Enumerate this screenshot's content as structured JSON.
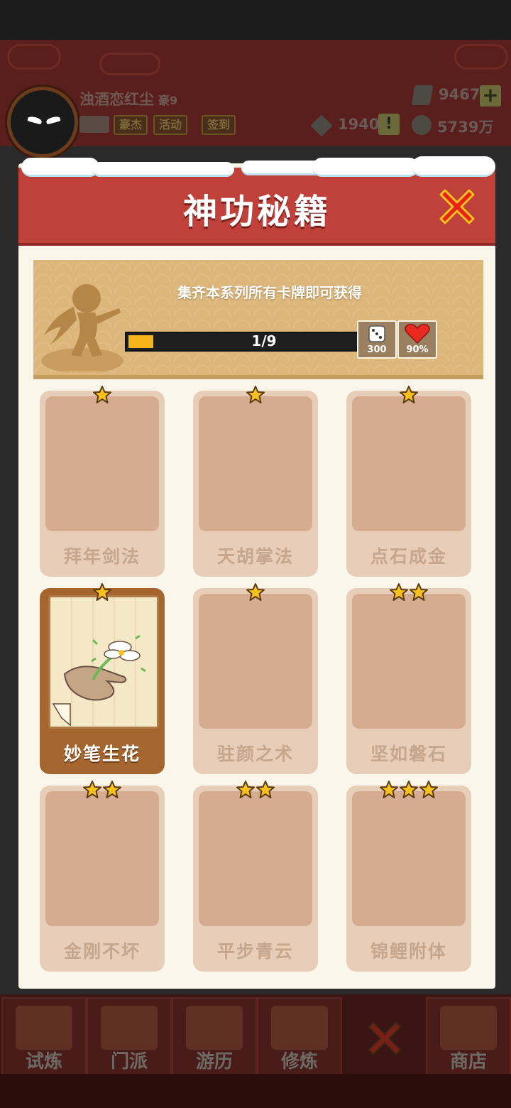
{
  "player": {
    "name": "浊酒恋红尘",
    "level": "豪9",
    "tags": [
      "豪杰",
      "活动",
      "签到"
    ]
  },
  "resources": {
    "gems": "9467",
    "tokens": "1940",
    "coins": "5739万"
  },
  "modal": {
    "title": "神功秘籍",
    "banner_text": "集齐本系列所有卡牌即可获得",
    "progress_label": "1/9",
    "progress": 0.11,
    "rewards": [
      {
        "icon": "dice-icon",
        "value": "300"
      },
      {
        "icon": "heart-icon",
        "value": "90%"
      }
    ]
  },
  "cards": [
    {
      "name": "拜年剑法",
      "stars": 1,
      "unlocked": false
    },
    {
      "name": "天胡掌法",
      "stars": 1,
      "unlocked": false
    },
    {
      "name": "点石成金",
      "stars": 1,
      "unlocked": false
    },
    {
      "name": "妙笔生花",
      "stars": 1,
      "unlocked": true
    },
    {
      "name": "驻颜之术",
      "stars": 1,
      "unlocked": false
    },
    {
      "name": "坚如磐石",
      "stars": 2,
      "unlocked": false
    },
    {
      "name": "金刚不坏",
      "stars": 2,
      "unlocked": false
    },
    {
      "name": "平步青云",
      "stars": 2,
      "unlocked": false
    },
    {
      "name": "锦鲤附体",
      "stars": 3,
      "unlocked": false
    }
  ],
  "nav": [
    {
      "label": "试炼",
      "icon": "trial-icon"
    },
    {
      "label": "门派",
      "icon": "sect-icon"
    },
    {
      "label": "游历",
      "icon": "travel-icon"
    },
    {
      "label": "修炼",
      "icon": "cultivate-icon"
    },
    {
      "label": "",
      "icon": "close-icon"
    },
    {
      "label": "商店",
      "icon": "shop-icon"
    }
  ],
  "colors": {
    "header": "#c0413a",
    "star": "#f6c21b",
    "progress": "#f4b41a"
  }
}
